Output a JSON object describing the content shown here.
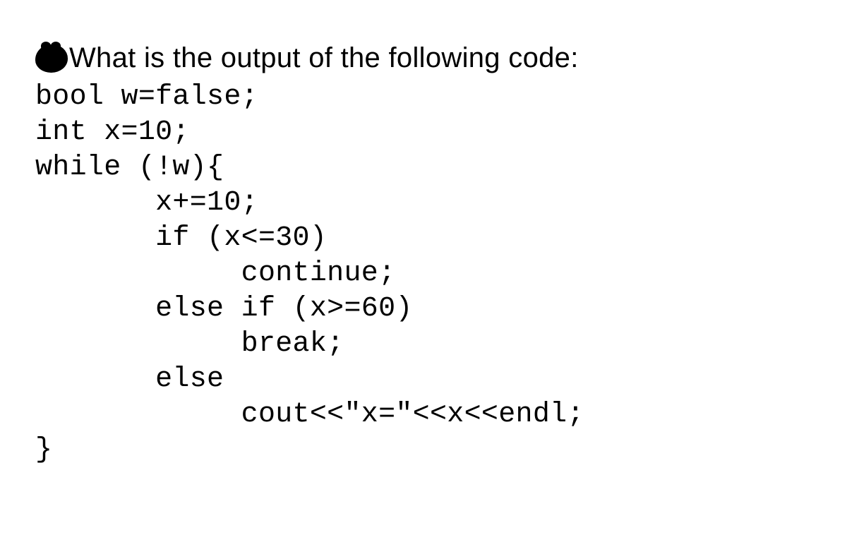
{
  "question": "What is the output of the following code:",
  "code": {
    "line1": "bool w=false;",
    "line2": "int x=10;",
    "line3": "while (!w){",
    "line4": "       x+=10;",
    "line5": "       if (x<=30)",
    "line6": "            continue;",
    "line7": "       else if (x>=60)",
    "line8": "            break;",
    "line9": "       else",
    "line10": "            cout<<\"x=\"<<x<<endl;",
    "line11": "}"
  }
}
